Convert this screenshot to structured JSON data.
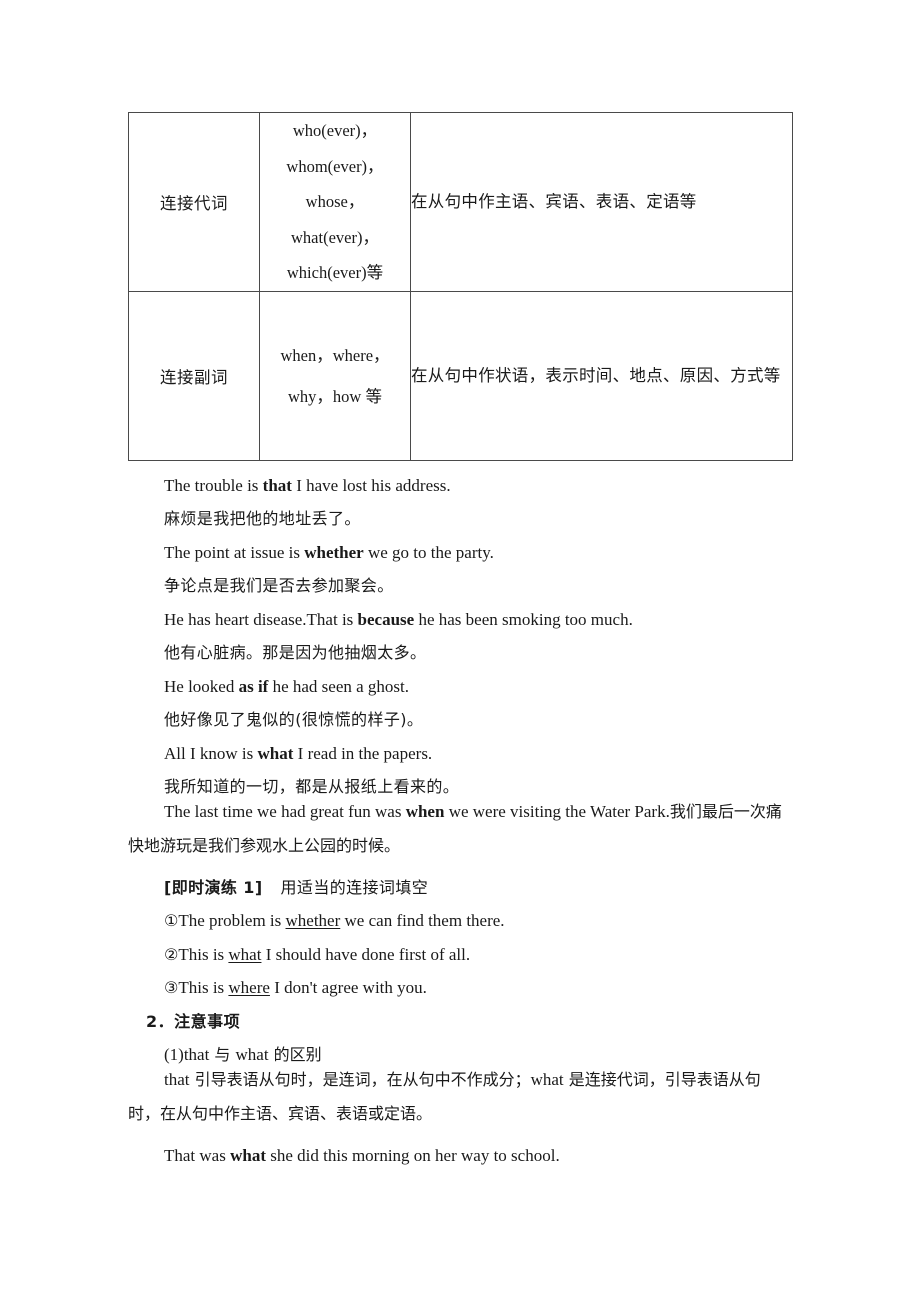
{
  "table": {
    "rows": [
      {
        "type": "连接代词",
        "words": [
          "who(ever)，",
          "whom(ever)，",
          "whose，",
          "what(ever)，",
          "which(ever)等"
        ],
        "function": "在从句中作主语、宾语、表语、定语等"
      },
      {
        "type": "连接副词",
        "words": [
          "when，where，",
          "why，how 等"
        ],
        "function": "在从句中作状语，表示时间、地点、原因、方式等"
      }
    ]
  },
  "examples": [
    {
      "en_before": "The trouble is ",
      "en_bold": "that",
      "en_after": " I have lost his address.",
      "zh": "麻烦是我把他的地址丢了。"
    },
    {
      "en_before": "The point at issue is ",
      "en_bold": "whether",
      "en_after": " we go to the party.",
      "zh": "争论点是我们是否去参加聚会。"
    },
    {
      "en_before": "He has heart disease.That is ",
      "en_bold": "because",
      "en_after": " he has been smoking too much.",
      "zh": "他有心脏病。那是因为他抽烟太多。"
    },
    {
      "en_before": "He looked ",
      "en_bold": "as if",
      "en_after": " he had seen a ghost.",
      "zh": "他好像见了鬼似的(很惊慌的样子)。"
    },
    {
      "en_before": "All I know is ",
      "en_bold": "what",
      "en_after": " I read in the papers.",
      "zh": "我所知道的一切，都是从报纸上看来的。"
    }
  ],
  "long_example": {
    "part1": "The last time we had great fun was ",
    "bold": "when",
    "part2": " we were visiting the Water Park.",
    "zh": "我们最后一次痛快地游玩是我们参观水上公园的时候。"
  },
  "practice": {
    "label": "[即时演练 1]",
    "instruction": "用适当的连接词填空",
    "items": [
      {
        "marker": "①",
        "before": "The problem is ",
        "answer": "whether",
        "after": " we can find them there."
      },
      {
        "marker": "②",
        "before": "This is ",
        "answer": "what",
        "after": " I should have done first of all."
      },
      {
        "marker": "③",
        "before": "This is ",
        "answer": "where",
        "after": " I don't agree with you."
      }
    ]
  },
  "notes": {
    "heading": "2．注意事项",
    "sub_heading_a": "(1)that",
    "sub_heading_b": " 与 ",
    "sub_heading_c": "what",
    "sub_heading_d": " 的区别",
    "paragraph_a": "that",
    "paragraph_b": " 引导表语从句时，是连词，在从句中不作成分；",
    "paragraph_c": "what",
    "paragraph_d": " 是连接代词，引导表语从句时，在从句中作主语、宾语、表语或定语。",
    "final_example": {
      "before": "That was ",
      "bold": "what",
      "after": " she did this morning on her way to school."
    }
  }
}
